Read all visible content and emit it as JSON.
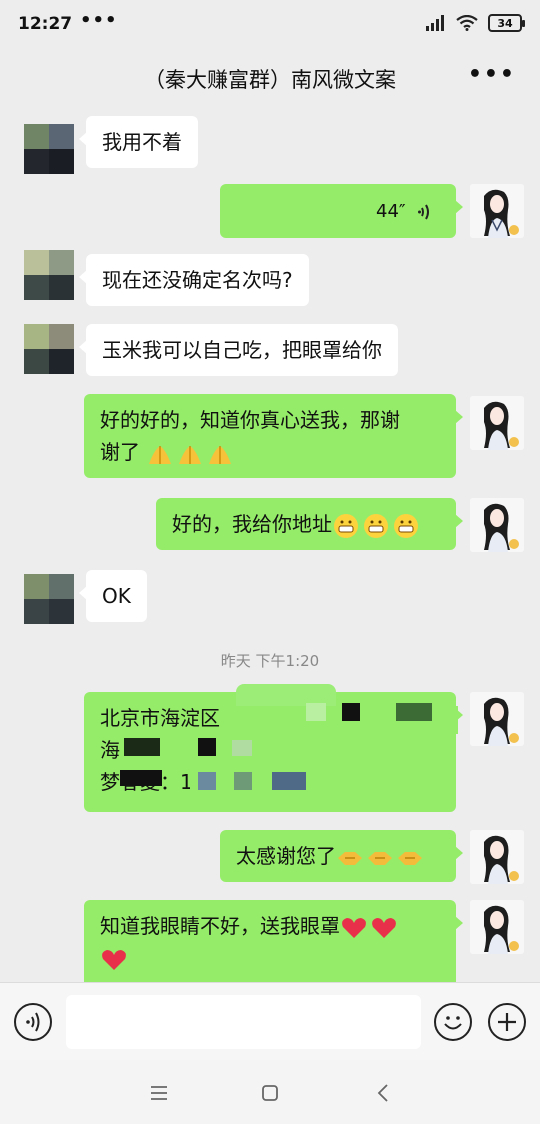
{
  "status_bar": {
    "time": "12:27",
    "dots": "•••",
    "battery": "34"
  },
  "header": {
    "title": "（秦大赚富群）南风微文案",
    "more_label": "•••"
  },
  "messages": [
    {
      "side": "other",
      "text": "我用不着"
    },
    {
      "side": "me",
      "voice_duration": "44″"
    },
    {
      "side": "other",
      "text": "现在还没确定名次吗?"
    },
    {
      "side": "other",
      "text": "玉米我可以自己吃，把眼罩给你"
    },
    {
      "side": "me",
      "text_line1": "好的好的，知道你真心送我，那谢",
      "text_line2": "谢了",
      "emoji": "folded-hands",
      "emoji_count": 3
    },
    {
      "side": "me",
      "text": "好的，我给你地址",
      "emoji": "grinning-face",
      "emoji_count": 3
    },
    {
      "side": "other",
      "text": "OK"
    },
    {
      "side": "me",
      "line1": "北京市海淀区",
      "line2": "海",
      "line3": "梦春夏：1"
    },
    {
      "side": "me",
      "text": "太感谢您了",
      "emoji": "handshake",
      "emoji_count": 3
    },
    {
      "side": "me",
      "text_line1": "知道我眼睛不好，送我眼罩",
      "emoji": "red-heart",
      "emoji_count": 3
    }
  ],
  "timestamp": "昨天 下午1:20",
  "input": {
    "placeholder": ""
  },
  "colors": {
    "background": "#ededed",
    "bubble_me": "#95ec69",
    "bubble_other": "#ffffff",
    "timestamp": "#888888"
  }
}
